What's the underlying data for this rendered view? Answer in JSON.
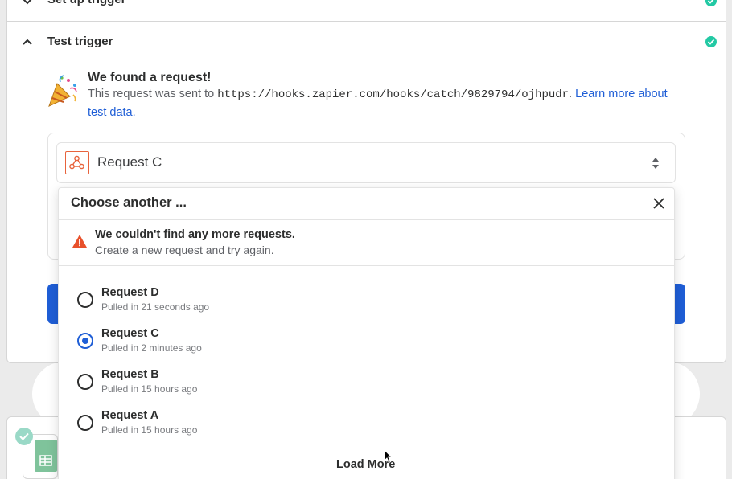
{
  "steps": {
    "setup": {
      "title": "Set up trigger",
      "status": "complete"
    },
    "test": {
      "title": "Test trigger",
      "status": "complete"
    }
  },
  "found": {
    "title": "We found a request!",
    "text_prefix": "This request was sent to",
    "url": "https://hooks.zapier.com/hooks/catch/9829794/ojhpudr",
    "text_period": ".",
    "link": "Learn more about test data."
  },
  "select": {
    "value": "Request C",
    "icon": "webhook-icon"
  },
  "popup": {
    "title": "Choose another ...",
    "warning_title": "We couldn't find any more requests.",
    "warning_text": "Create a new request and try again.",
    "options": [
      {
        "label": "Request D",
        "sub": "Pulled in 21 seconds ago",
        "selected": false
      },
      {
        "label": "Request C",
        "sub": "Pulled in 2 minutes ago",
        "selected": true
      },
      {
        "label": "Request B",
        "sub": "Pulled in 15 hours ago",
        "selected": false
      },
      {
        "label": "Request A",
        "sub": "Pulled in 15 hours ago",
        "selected": false
      }
    ],
    "load_more": "Load More"
  },
  "colors": {
    "accent": "#1f5ed6",
    "success": "#23c9a4",
    "webhook": "#e8633c",
    "warning": "#e8502b"
  }
}
